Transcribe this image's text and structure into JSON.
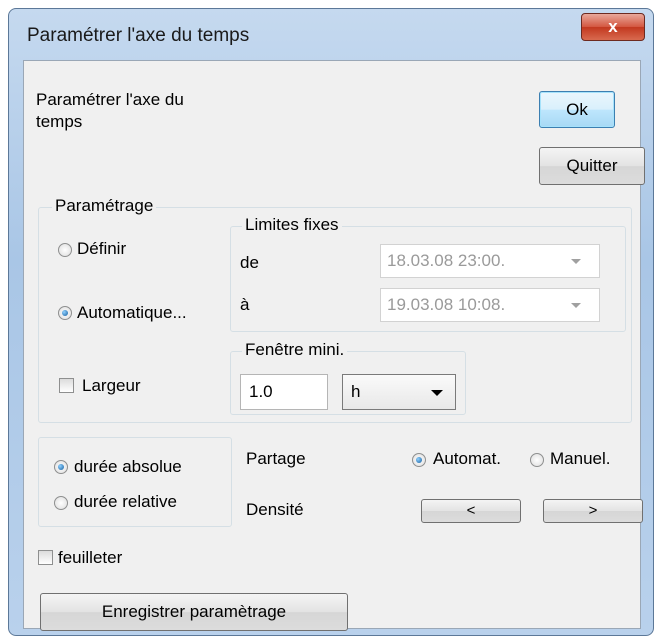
{
  "window": {
    "title": "Paramétrer l'axe du temps",
    "close_glyph": "x"
  },
  "header": {
    "description": "Paramétrer l'axe du temps"
  },
  "buttons": {
    "ok": "Ok",
    "quit": "Quitter",
    "save": "Enregistrer paramètrage"
  },
  "parametrage": {
    "legend": "Paramétrage",
    "define_label": "Définir",
    "auto_label": "Automatique...",
    "width_label": "Largeur",
    "selected": "auto"
  },
  "limits": {
    "legend": "Limites fixes",
    "from_label": "de",
    "from_value": "18.03.08  23:00.",
    "to_label": "à",
    "to_value": "19.03.08  10:08."
  },
  "min_window": {
    "legend": "Fenêtre mini.",
    "value": "1.0",
    "unit": "h"
  },
  "duration": {
    "absolute_label": "durée absolue",
    "relative_label": "durée relative",
    "selected": "absolute"
  },
  "partage": {
    "label": "Partage",
    "auto_label": "Automat.",
    "manual_label": "Manuel.",
    "selected": "auto"
  },
  "density": {
    "label": "Densité",
    "less": "<",
    "more": ">"
  },
  "browse": {
    "label": "feuilleter",
    "checked": false
  },
  "colors": {
    "accent": "#155e9e",
    "frame": "#a9c6e6",
    "close": "#c2381f"
  }
}
